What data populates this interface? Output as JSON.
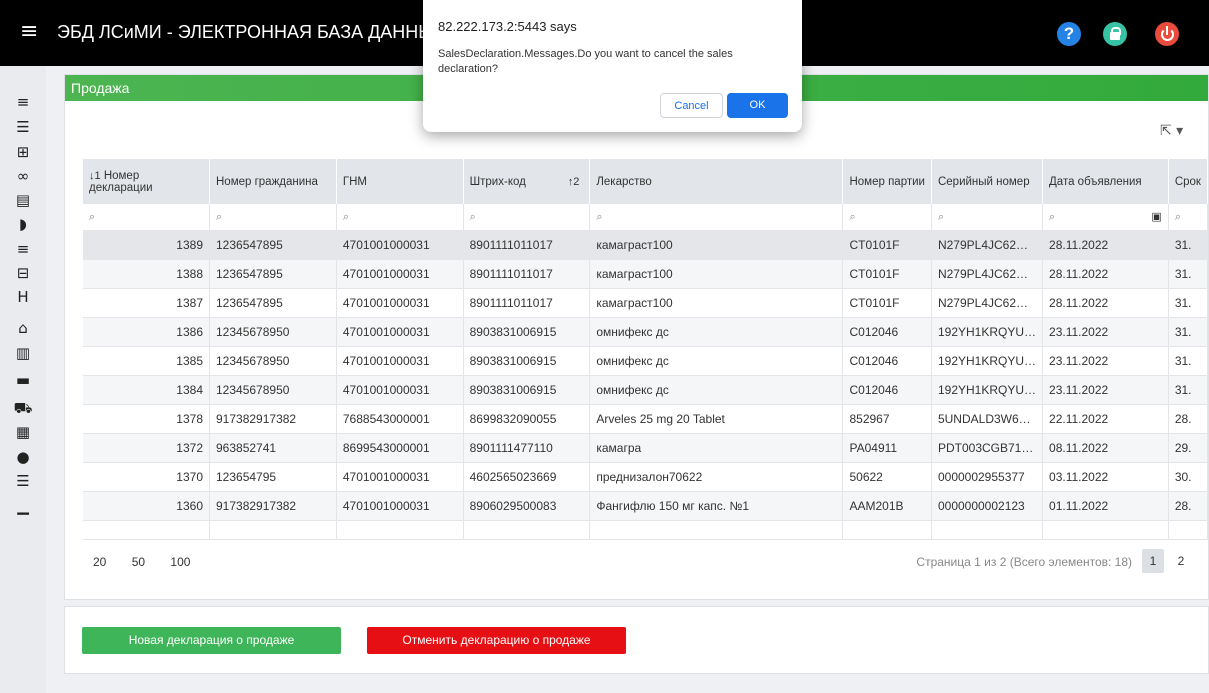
{
  "header": {
    "title": "ЭБД ЛСиМИ - ЭЛЕКТРОННАЯ БАЗА ДАННЫХ Л",
    "help_label": "?"
  },
  "sidebar": {
    "items": [
      {
        "name": "checklist-icon",
        "glyph": "≡"
      },
      {
        "name": "indent-list-icon",
        "glyph": "☰"
      },
      {
        "name": "medkit-icon",
        "glyph": "⊞"
      },
      {
        "name": "pills-icon",
        "glyph": "∞"
      },
      {
        "name": "clipboard-icon",
        "glyph": "▤"
      },
      {
        "name": "hearing-icon",
        "glyph": "◗"
      },
      {
        "name": "checklist-icon-2",
        "glyph": "≡"
      },
      {
        "name": "first-aid-icon",
        "glyph": "⊟"
      },
      {
        "name": "hospital-icon",
        "glyph": "H"
      },
      {
        "name": "warehouse-icon",
        "glyph": "⌂"
      },
      {
        "name": "building-icon",
        "glyph": "▥"
      },
      {
        "name": "toolbox-icon",
        "glyph": "▬"
      },
      {
        "name": "ambulance-icon",
        "glyph": "⛟"
      },
      {
        "name": "list-box-icon",
        "glyph": "▦"
      },
      {
        "name": "user-icon",
        "glyph": "●"
      },
      {
        "name": "indent-icon",
        "glyph": "☰"
      },
      {
        "name": "chart-icon",
        "glyph": "▁"
      }
    ]
  },
  "panel": {
    "title": "Продажа"
  },
  "table": {
    "columns": [
      {
        "label": "Номер декларации",
        "sort": "↓1"
      },
      {
        "label": "Номер гражданина",
        "sort": ""
      },
      {
        "label": "ГНМ",
        "sort": ""
      },
      {
        "label": "Штрих-код",
        "sort": "↑2"
      },
      {
        "label": "Лекарство",
        "sort": ""
      },
      {
        "label": "Номер партии",
        "sort": ""
      },
      {
        "label": "Серийный номер",
        "sort": ""
      },
      {
        "label": "Дата объявления",
        "sort": ""
      },
      {
        "label": "Срок",
        "sort": ""
      }
    ],
    "rows": [
      [
        "1389",
        "1236547895",
        "4701001000031",
        "8901111011017",
        "камаграст100",
        "CT0101F",
        "N279PL4JC62…",
        "28.11.2022",
        "31."
      ],
      [
        "1388",
        "1236547895",
        "4701001000031",
        "8901111011017",
        "камаграст100",
        "CT0101F",
        "N279PL4JC62…",
        "28.11.2022",
        "31."
      ],
      [
        "1387",
        "1236547895",
        "4701001000031",
        "8901111011017",
        "камаграст100",
        "CT0101F",
        "N279PL4JC62…",
        "28.11.2022",
        "31."
      ],
      [
        "1386",
        "12345678950",
        "4701001000031",
        "8903831006915",
        "омнифекс дс",
        "C012046",
        "192YH1KRQYU…",
        "23.11.2022",
        "31."
      ],
      [
        "1385",
        "12345678950",
        "4701001000031",
        "8903831006915",
        "омнифекс дс",
        "C012046",
        "192YH1KRQYU…",
        "23.11.2022",
        "31."
      ],
      [
        "1384",
        "12345678950",
        "4701001000031",
        "8903831006915",
        "омнифекс дс",
        "C012046",
        "192YH1KRQYU…",
        "23.11.2022",
        "31."
      ],
      [
        "1378",
        "917382917382",
        "7688543000001",
        "8699832090055",
        "Arveles 25 mg 20 Tablet",
        "852967",
        "5UNDALD3W6…",
        "22.11.2022",
        "28."
      ],
      [
        "1372",
        "963852741",
        "8699543000001",
        "8901111477110",
        "камагра",
        "PA04911",
        "PDT003CGB71…",
        "08.11.2022",
        "29."
      ],
      [
        "1370",
        "123654795",
        "4701001000031",
        "4602565023669",
        "преднизалон70622",
        "50622",
        "0000002955377",
        "03.11.2022",
        "30."
      ],
      [
        "1360",
        "917382917382",
        "4701001000031",
        "8906029500083",
        "Фангифлю 150 мг капс. №1",
        "AAM201B",
        "0000000002123",
        "01.11.2022",
        "28."
      ]
    ]
  },
  "pager": {
    "sizes": [
      "20",
      "50",
      "100"
    ],
    "info": "Страница 1 из 2 (Всего элементов: 18)",
    "current": "1",
    "next": "2"
  },
  "actions": {
    "new_label": "Новая декларация о продаже",
    "cancel_label": "Отменить декларацию о продаже"
  },
  "dialog": {
    "origin": "82.222.173.2:5443 says",
    "message": "SalesDeclaration.Messages.Do you want to cancel the sales declaration?",
    "cancel_label": "Cancel",
    "ok_label": "OK"
  },
  "colors": {
    "header_green": "#4cb551",
    "new_button": "#3fb55a",
    "cancel_button": "#e50f14",
    "dialog_ok": "#1a73e8"
  }
}
